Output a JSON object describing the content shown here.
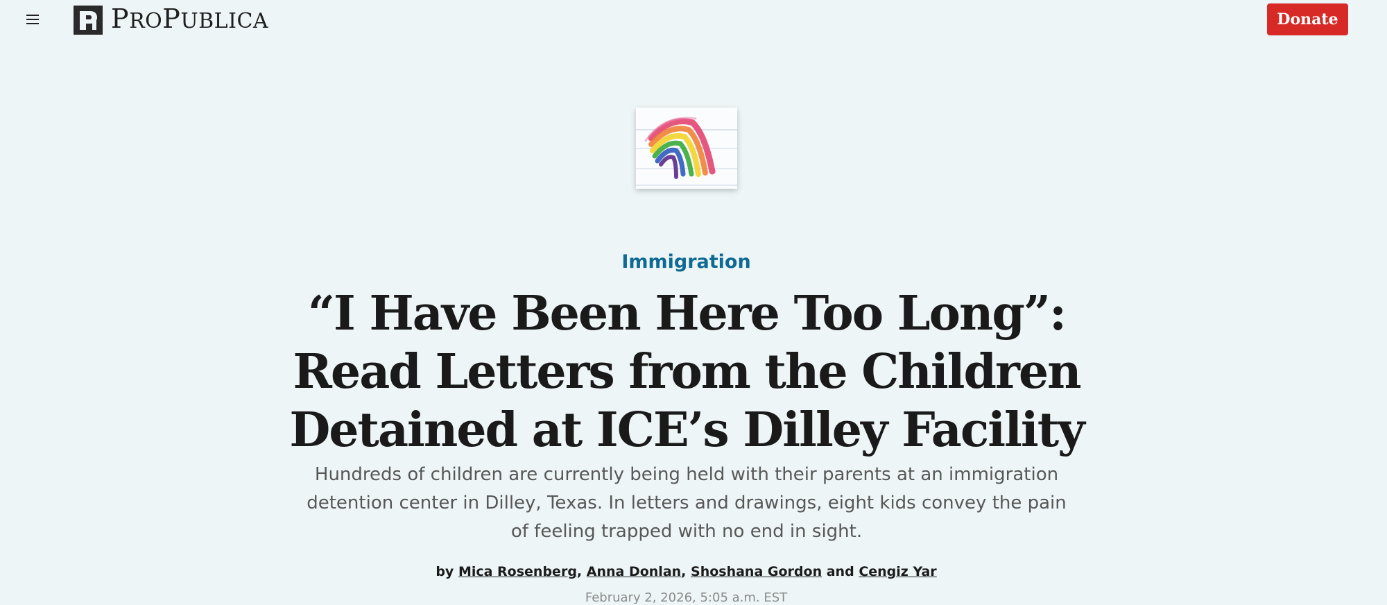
{
  "header": {
    "menu_icon": "hamburger-menu-icon",
    "logo_icon": "propublica-pi-logo-icon",
    "logo_text": "ProPublica",
    "donate_label": "Donate",
    "donate_color": "#d72a27"
  },
  "hero": {
    "image_name": "child-rainbow-drawing"
  },
  "article": {
    "category": "Immigration",
    "category_color": "#0f6a93",
    "headline": "“I Have Been Here Too Long”: Read Letters from the Children Detained at ICE’s Dilley Facility",
    "dek": "Hundreds of children are currently being held with their parents at an immigration detention center in Dilley, Texas. In letters and drawings, eight kids convey the pain of feeling trapped with no end in sight.",
    "byline": {
      "prefix": "by",
      "authors": [
        "Mica Rosenberg",
        "Anna Donlan",
        "Shoshana Gordon",
        "Cengiz Yar"
      ],
      "separator_1": ",",
      "separator_2": ",",
      "conjunction": "and"
    },
    "dateline": "February 2, 2026, 5:05 a.m. EST"
  },
  "colors": {
    "page_background": "#edf5f6",
    "headline_text": "#1a1a1a",
    "dek_text": "#575757"
  }
}
